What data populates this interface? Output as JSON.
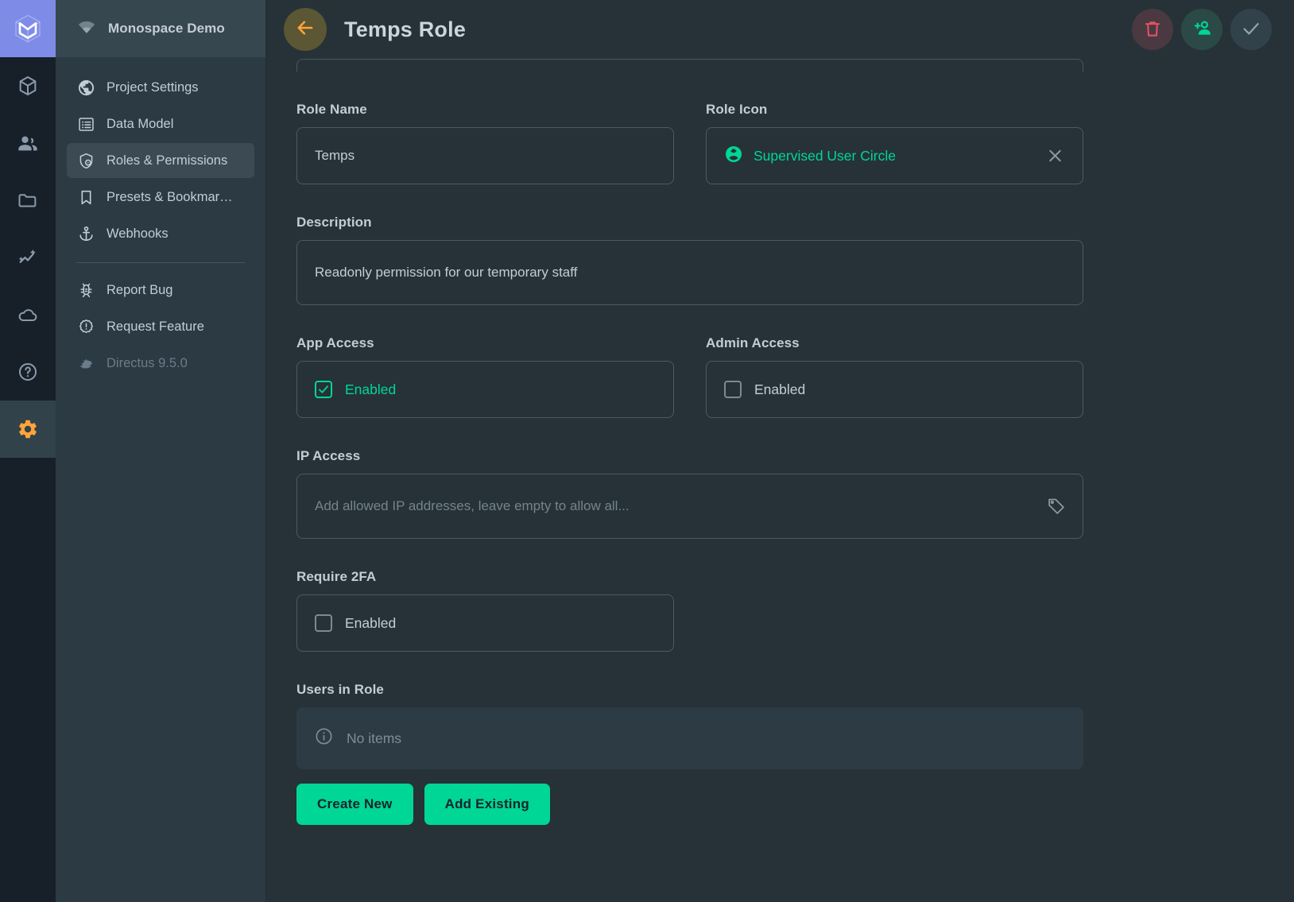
{
  "rail": {
    "logo_name": "directus-logo",
    "items": [
      {
        "name": "content-module",
        "icon": "box-icon",
        "active": false
      },
      {
        "name": "users-module",
        "icon": "people-icon",
        "active": false
      },
      {
        "name": "files-module",
        "icon": "folder-icon",
        "active": false
      },
      {
        "name": "insights-module",
        "icon": "insights-icon",
        "active": false
      },
      {
        "name": "cloud-module",
        "icon": "cloud-icon",
        "active": false
      },
      {
        "name": "help-module",
        "icon": "help-circle-icon",
        "active": false
      },
      {
        "name": "settings-module",
        "icon": "gear-icon",
        "active": true
      }
    ]
  },
  "sidebar": {
    "project_name": "Monospace Demo",
    "project_icon": "wifi-icon",
    "items": [
      {
        "label": "Project Settings",
        "icon": "globe-icon",
        "active": false,
        "muted": false
      },
      {
        "label": "Data Model",
        "icon": "list-box-icon",
        "active": false,
        "muted": false
      },
      {
        "label": "Roles & Permissions",
        "icon": "shield-icon",
        "active": true,
        "muted": false
      },
      {
        "label": "Presets & Bookmar…",
        "icon": "bookmark-icon",
        "active": false,
        "muted": false
      },
      {
        "label": "Webhooks",
        "icon": "anchor-icon",
        "active": false,
        "muted": false
      }
    ],
    "secondary_items": [
      {
        "label": "Report Bug",
        "icon": "bug-icon",
        "muted": false
      },
      {
        "label": "Request Feature",
        "icon": "alert-badge-icon",
        "muted": false
      },
      {
        "label": "Directus 9.5.0",
        "icon": "rabbit-icon",
        "muted": true
      }
    ]
  },
  "header": {
    "title": "Temps Role",
    "back_icon": "arrow-left-icon",
    "actions": [
      {
        "name": "delete-role-button",
        "icon": "trash-icon"
      },
      {
        "name": "invite-users-button",
        "icon": "person-add-icon"
      },
      {
        "name": "save-button",
        "icon": "check-icon"
      }
    ]
  },
  "form": {
    "role_name": {
      "label": "Role Name",
      "value": "Temps"
    },
    "role_icon": {
      "label": "Role Icon",
      "value": "Supervised User Circle",
      "icon": "supervised-user-circle-icon",
      "clear_icon": "close-icon"
    },
    "description": {
      "label": "Description",
      "value": "Readonly permission for our temporary staff"
    },
    "app_access": {
      "label": "App Access",
      "checkbox_label": "Enabled",
      "checked": true
    },
    "admin_access": {
      "label": "Admin Access",
      "checkbox_label": "Enabled",
      "checked": false
    },
    "ip_access": {
      "label": "IP Access",
      "value": "",
      "placeholder": "Add allowed IP addresses, leave empty to allow all...",
      "trail_icon": "tag-icon"
    },
    "require_2fa": {
      "label": "Require 2FA",
      "checkbox_label": "Enabled",
      "checked": false
    },
    "users_in_role": {
      "label": "Users in Role",
      "empty_text": "No items",
      "empty_icon": "info-circle-icon",
      "create_new_label": "Create New",
      "add_existing_label": "Add Existing"
    }
  },
  "colors": {
    "accent_green": "#00d696",
    "danger_red": "#e35169",
    "settings_amber": "#ffa439",
    "logo_purple": "#7e8ce8",
    "page_bg": "#263238",
    "sidebar_bg": "#2c3a43",
    "rail_bg": "#172028"
  }
}
